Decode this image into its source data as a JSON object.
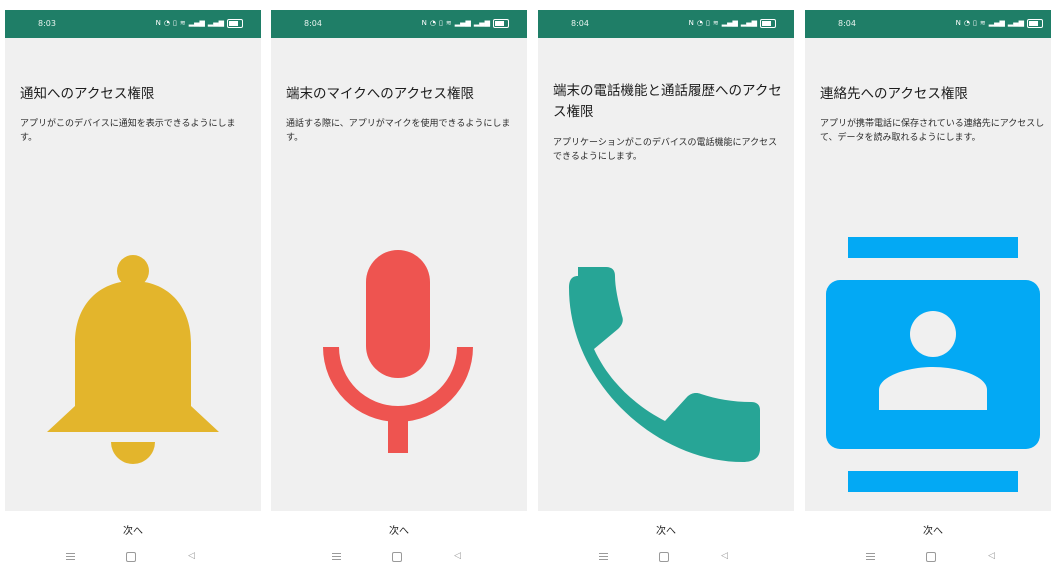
{
  "screens": [
    {
      "time": "8:03",
      "title": "通知へのアクセス権限",
      "description": "アプリがこのデバイスに通知を表示できるようにします。",
      "icon": "bell-icon",
      "icon_color": "#e3b52c",
      "next_label": "次へ"
    },
    {
      "time": "8:04",
      "title": "端末のマイクへのアクセス権限",
      "description": "通話する際に、アプリがマイクを使用できるようにします。",
      "icon": "microphone-icon",
      "icon_color": "#ee5450",
      "next_label": "次へ"
    },
    {
      "time": "8:04",
      "title": "端末の電話機能と通話履歴へのアクセス権限",
      "description": "アプリケーションがこのデバイスの電話機能にアクセスできるようにします。",
      "icon": "phone-icon",
      "icon_color": "#27a596",
      "next_label": "次へ"
    },
    {
      "time": "8:04",
      "title": "連絡先へのアクセス権限",
      "description": "アプリが携帯電話に保存されている連絡先にアクセスして、データを読み取れるようにします。",
      "icon": "contacts-icon",
      "icon_color": "#03a9f4",
      "next_label": "次へ"
    }
  ],
  "status_bar_color": "#1f7e67",
  "background_color": "#f0f0f0"
}
